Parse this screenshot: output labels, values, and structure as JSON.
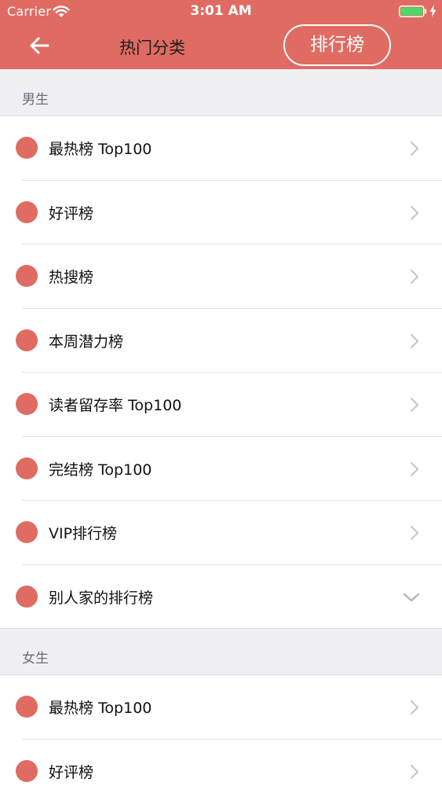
{
  "status_bar": {
    "carrier": "Carrier",
    "time": "3:01 AM",
    "battery_color": "#4cd964"
  },
  "nav": {
    "title": "热门分类",
    "rank_button_label": "排行榜",
    "back_icon": "arrow-left-icon",
    "accent_color": "#e06b62"
  },
  "sections": [
    {
      "title": "男生",
      "items": [
        {
          "label": "最热榜 Top100",
          "indicator": "chevron-right-icon"
        },
        {
          "label": "好评榜",
          "indicator": "chevron-right-icon"
        },
        {
          "label": "热搜榜",
          "indicator": "chevron-right-icon"
        },
        {
          "label": "本周潜力榜",
          "indicator": "chevron-right-icon"
        },
        {
          "label": "读者留存率 Top100",
          "indicator": "chevron-right-icon"
        },
        {
          "label": "完结榜 Top100",
          "indicator": "chevron-right-icon"
        },
        {
          "label": "VIP排行榜",
          "indicator": "chevron-right-icon"
        },
        {
          "label": "别人家的排行榜",
          "indicator": "chevron-down-icon"
        }
      ]
    },
    {
      "title": "女生",
      "items": [
        {
          "label": "最热榜 Top100",
          "indicator": "chevron-right-icon"
        },
        {
          "label": "好评榜",
          "indicator": "chevron-right-icon"
        }
      ]
    }
  ]
}
